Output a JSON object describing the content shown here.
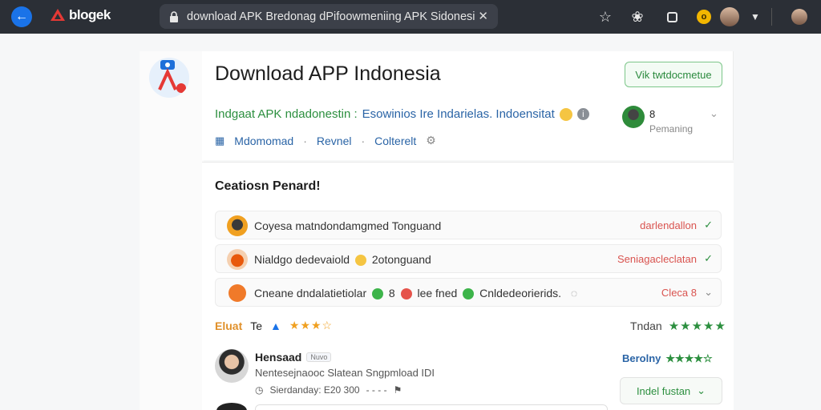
{
  "browser": {
    "brand": "blogek",
    "url": "download APK Bredonag dPifoowmeniing APK Sidonesial Tl",
    "close_symbol": "✕"
  },
  "app": {
    "title": "Download APP Indonesia",
    "cta_label": "Vik twtdocmetue",
    "subtitle_green": "Indgaat APK ndadonestin :",
    "subtitle_blue": "Esowinios Ire Indarielas. Indoensitat",
    "meta": [
      "Mdomomad",
      "Revnel",
      "Colterelt"
    ],
    "developer_name": "8",
    "developer_sub": "Pemaning"
  },
  "section": {
    "title": "Ceatiosn Penard!",
    "rows": [
      {
        "text": "Coyesa matndondamgmed Tonguand",
        "status": "darlendallon"
      },
      {
        "text": "Nialdgo dedevaiold",
        "text2": "2otonguand",
        "status": "Seniagacleclatan"
      },
      {
        "text": "Cneane dndalatietiolar",
        "text2": "8",
        "text3": "lee fned",
        "text4": "Cnldedeorierids.",
        "status": "Cleca 8"
      }
    ]
  },
  "ratings": {
    "label": "Eluat",
    "value": "Te",
    "right_label": "Tndan"
  },
  "review": {
    "name": "Hensaad",
    "tag": "Nuvo",
    "text": "Nentesejnaooc Slatean Sngpmload IDI",
    "meta": "Sierdanday: E20 300",
    "dashes": "- - - -",
    "rating_label": "Berolny",
    "helpful_label": "Indel fustan"
  },
  "colors": {
    "topbar": "#2b2f36",
    "accent_blue": "#1a73e8",
    "green": "#2c8f3f",
    "red": "#d9534f",
    "star": "#f0a020"
  }
}
